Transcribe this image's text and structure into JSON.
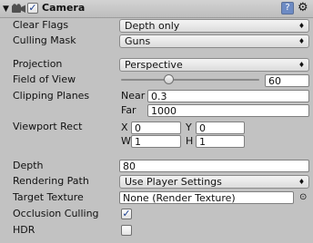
{
  "header": {
    "title": "Camera",
    "enabled": true,
    "foldout_glyph": "▼",
    "help_glyph": "?",
    "gear_glyph": "⚙"
  },
  "rows": {
    "clear_flags": {
      "label": "Clear Flags",
      "value": "Depth only"
    },
    "culling_mask": {
      "label": "Culling Mask",
      "value": "Guns"
    },
    "projection": {
      "label": "Projection",
      "value": "Perspective"
    },
    "field_of_view": {
      "label": "Field of View",
      "value": "60",
      "slider_fraction": 0.33
    },
    "clipping_planes": {
      "label": "Clipping Planes",
      "near_label": "Near",
      "near_value": "0.3",
      "far_label": "Far",
      "far_value": "1000"
    },
    "viewport_rect": {
      "label": "Viewport Rect",
      "x_label": "X",
      "x_value": "0",
      "y_label": "Y",
      "y_value": "0",
      "w_label": "W",
      "w_value": "1",
      "h_label": "H",
      "h_value": "1"
    },
    "depth": {
      "label": "Depth",
      "value": "80"
    },
    "rendering_path": {
      "label": "Rendering Path",
      "value": "Use Player Settings"
    },
    "target_texture": {
      "label": "Target Texture",
      "value": "None (Render Texture)",
      "picker_glyph": "⊙"
    },
    "occlusion_culling": {
      "label": "Occlusion Culling",
      "checked": true,
      "check_glyph": "✓"
    },
    "hdr": {
      "label": "HDR",
      "checked": false,
      "check_glyph": ""
    }
  },
  "dropdown_arrow": "♦",
  "colors": {
    "panel_bg": "#c2c2c2",
    "field_bg": "#ffffff",
    "accent": "#6d8bc4"
  }
}
